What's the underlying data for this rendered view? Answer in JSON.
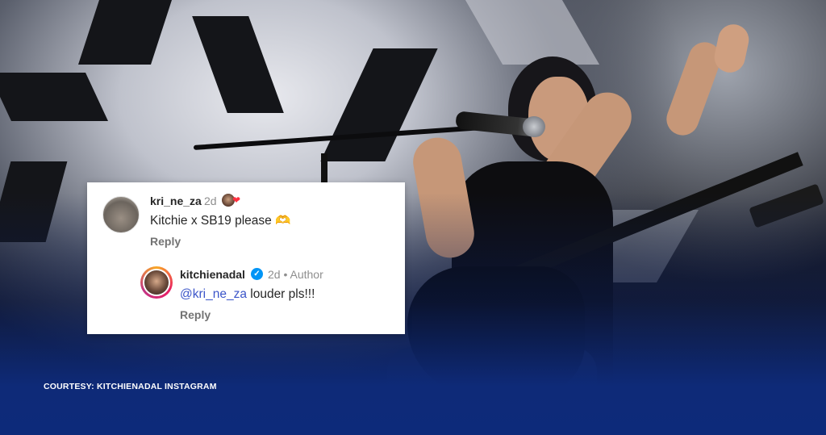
{
  "credit": "COURTESY: KITCHIENADAL INSTAGRAM",
  "comment": {
    "username": "kri_ne_za",
    "time": "2d",
    "text": "Kitchie x SB19 please 🫶",
    "reply_label": "Reply",
    "liked_by_author_icon": "heart-icon"
  },
  "reply": {
    "username": "kitchienadal",
    "verified": true,
    "time_author": "2d • Author",
    "mention": "@kri_ne_za",
    "text": " louder pls!!!",
    "reply_label": "Reply"
  },
  "colors": {
    "mention": "#3b55c9",
    "verified": "#0095f6",
    "heart": "#ff3040",
    "overlay_blue": "#0d2a7a"
  }
}
